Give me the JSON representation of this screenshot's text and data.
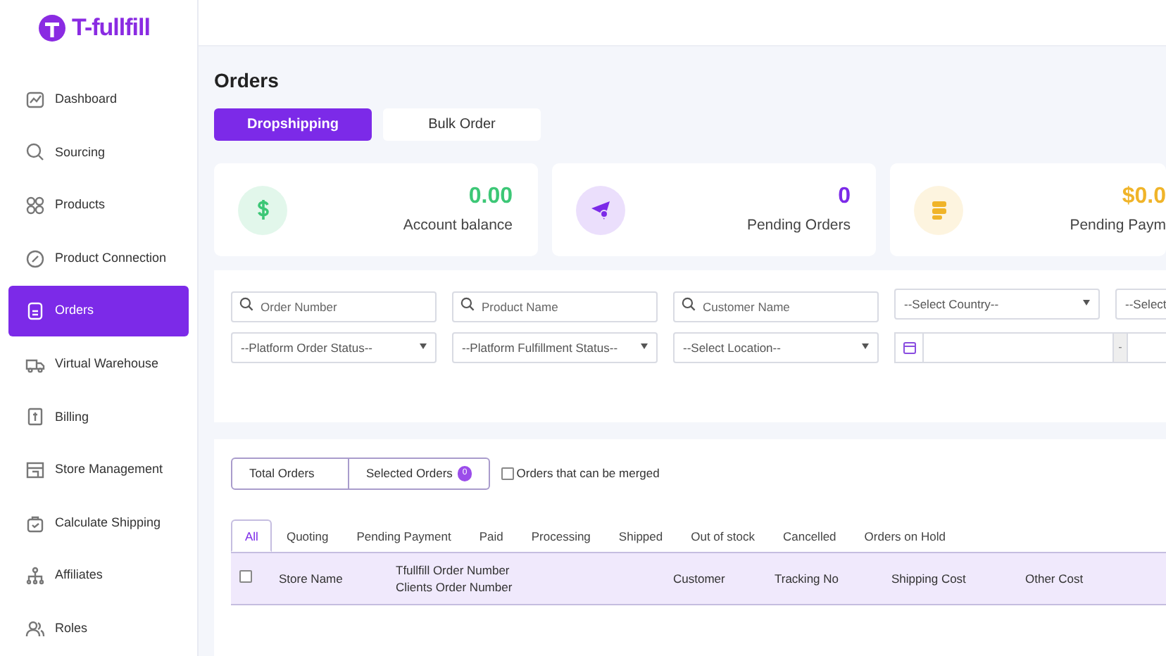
{
  "brand": {
    "name": "T-fullfill"
  },
  "sidebar": {
    "items": [
      {
        "label": "Dashboard",
        "selected": false
      },
      {
        "label": "Sourcing",
        "selected": false
      },
      {
        "label": "Products",
        "selected": false
      },
      {
        "label": "Product Connection",
        "selected": false
      },
      {
        "label": "Orders",
        "selected": true
      },
      {
        "label": "Virtual Warehouse",
        "selected": false
      },
      {
        "label": "Billing",
        "selected": false
      },
      {
        "label": "Store Management",
        "selected": false
      },
      {
        "label": "Calculate Shipping",
        "selected": false
      },
      {
        "label": "Affiliates",
        "selected": false
      },
      {
        "label": "Roles",
        "selected": false
      }
    ]
  },
  "page_title": "Orders",
  "order_types": [
    {
      "label": "Dropshipping",
      "selected": true
    },
    {
      "label": "Bulk Order",
      "selected": false
    }
  ],
  "stats": [
    {
      "value": "0.00",
      "label": "Account balance",
      "color": "#3cc776"
    },
    {
      "value": "0",
      "label": "Pending Orders",
      "color": "#7c2ae8"
    },
    {
      "value": "$0.0",
      "label": "Pending Paym",
      "color": "#f0b429"
    }
  ],
  "filters": [
    {
      "kind": "search",
      "placeholder": "Order Number"
    },
    {
      "kind": "search",
      "placeholder": "Product Name"
    },
    {
      "kind": "search",
      "placeholder": "Customer Name"
    },
    {
      "kind": "select",
      "value": "--Select Country--"
    },
    {
      "kind": "select",
      "value": "--Select"
    },
    {
      "kind": "select",
      "value": "--Platform Order Status--"
    },
    {
      "kind": "select",
      "value": "--Platform Fulfillment Status--"
    },
    {
      "kind": "select",
      "value": "--Select Location--"
    },
    {
      "kind": "daterange",
      "separator": "-"
    }
  ],
  "order_counts": [
    {
      "label": "Total Orders"
    },
    {
      "label": "Selected Orders",
      "badge": "0"
    }
  ],
  "merge_filter": {
    "label": "Orders that can be merged",
    "checked": false
  },
  "status_tabs": [
    {
      "label": "All",
      "selected": true
    },
    {
      "label": "Quoting",
      "selected": false
    },
    {
      "label": "Pending Payment",
      "selected": false
    },
    {
      "label": "Paid",
      "selected": false
    },
    {
      "label": "Processing",
      "selected": false
    },
    {
      "label": "Shipped",
      "selected": false
    },
    {
      "label": "Out of stock",
      "selected": false
    },
    {
      "label": "Cancelled",
      "selected": false
    },
    {
      "label": "Orders on Hold",
      "selected": false
    }
  ],
  "table": {
    "select_all_checked": false,
    "columns": [
      {
        "label": "Store Name"
      },
      {
        "label": "Tfullfill Order Number",
        "sub_label": "Clients Order Number"
      },
      {
        "label": "Customer"
      },
      {
        "label": "Tracking No"
      },
      {
        "label": "Shipping Cost"
      },
      {
        "label": "Other Cost"
      }
    ]
  }
}
